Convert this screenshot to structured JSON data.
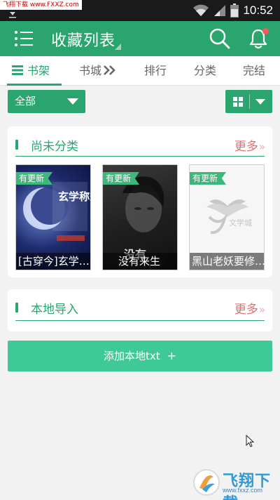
{
  "status_bar": {
    "watermark_text": "飞翔下载 www.FXXZ.com",
    "time": "10:52"
  },
  "app_bar": {
    "title": "收藏列表",
    "icons": {
      "menu": "menu-list-icon",
      "search": "search-icon",
      "notification": "bell-icon"
    },
    "has_notification_dot": true
  },
  "tabs": [
    {
      "label": "书架",
      "active": true,
      "icon": "list-icon"
    },
    {
      "label": "书城",
      "active": false,
      "icon": "double-chevron-right-icon"
    },
    {
      "label": "排行",
      "active": false
    },
    {
      "label": "分类",
      "active": false
    },
    {
      "label": "完结",
      "active": false
    }
  ],
  "filter": {
    "selected": "全部",
    "view_mode_icon": "grid-icon"
  },
  "sections": {
    "uncategorized": {
      "title": "尚未分类",
      "more_label": "更多",
      "books": [
        {
          "title": "[古穿今]玄学…",
          "badge": "有更新",
          "cover_text": "玄学称霸现代"
        },
        {
          "title": "没有来生",
          "badge": "有更新",
          "cover_text": "没有"
        },
        {
          "title": "黑山老妖要修…",
          "badge": "有更新",
          "cover_text": "文学城"
        }
      ]
    },
    "local_import": {
      "title": "本地导入",
      "more_label": "更多"
    }
  },
  "add_local_button": {
    "label": "添加本地txt",
    "plus": "+"
  },
  "watermark": {
    "brand": "飞翔下载",
    "url": "www.fxxz.com"
  },
  "colors": {
    "primary": "#2aa56f",
    "button": "#3ec997",
    "more": "#e5716e",
    "status_bar": "#1a1a1a",
    "background": "#f2f2f2"
  }
}
